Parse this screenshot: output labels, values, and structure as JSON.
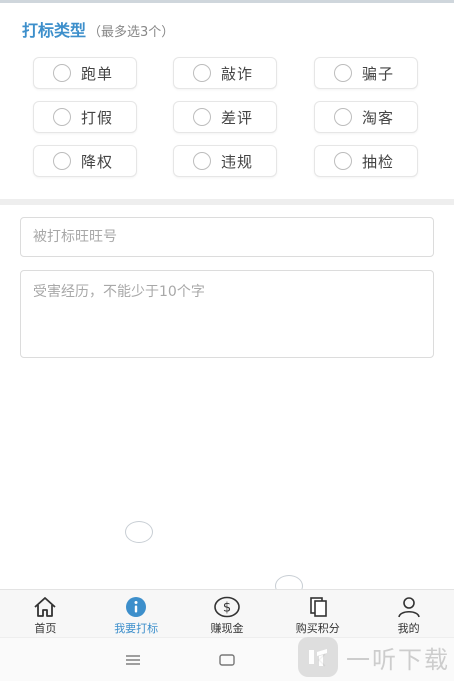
{
  "header": {
    "title": "打标类型",
    "hint": "（最多选3个）"
  },
  "options": [
    {
      "label": "跑单"
    },
    {
      "label": "敲诈"
    },
    {
      "label": "骗子"
    },
    {
      "label": "打假"
    },
    {
      "label": "差评"
    },
    {
      "label": "淘客"
    },
    {
      "label": "降权"
    },
    {
      "label": "违规"
    },
    {
      "label": "抽检"
    }
  ],
  "form": {
    "wangwang_placeholder": "被打标旺旺号",
    "experience_placeholder": "受害经历，不能少于10个字"
  },
  "tabs": [
    {
      "label": "首页",
      "icon": "home-icon"
    },
    {
      "label": "我要打标",
      "icon": "info-icon"
    },
    {
      "label": "赚现金",
      "icon": "dollar-icon"
    },
    {
      "label": "购买积分",
      "icon": "copy-icon"
    },
    {
      "label": "我的",
      "icon": "user-icon"
    }
  ],
  "colors": {
    "accent": "#3d8fcb"
  },
  "watermark": {
    "text": "一听下载"
  }
}
